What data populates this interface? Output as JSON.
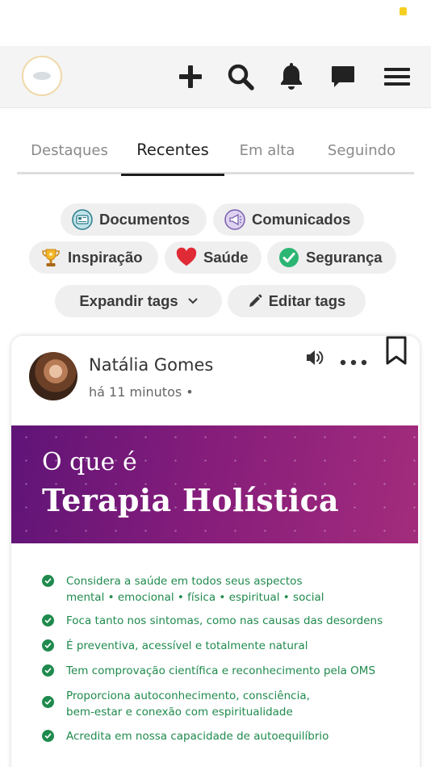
{
  "header": {
    "logo_name": "company-logo",
    "actions": [
      "add-icon",
      "search-icon",
      "bell-icon",
      "chat-icon",
      "menu-icon"
    ]
  },
  "tabs": [
    {
      "label": "Destaques",
      "active": false
    },
    {
      "label": "Recentes",
      "active": true
    },
    {
      "label": "Em alta",
      "active": false
    },
    {
      "label": "Seguindo",
      "active": false
    }
  ],
  "tags": [
    {
      "label": "Documentos",
      "icon": "newspaper-icon"
    },
    {
      "label": "Comunicados",
      "icon": "megaphone-icon"
    },
    {
      "label": "Inspiração",
      "icon": "trophy-icon"
    },
    {
      "label": "Saúde",
      "icon": "heart-icon"
    },
    {
      "label": "Segurança",
      "icon": "check-icon"
    }
  ],
  "tag_actions": {
    "expand_label": "Expandir tags",
    "edit_label": "Editar tags"
  },
  "post": {
    "author": "Natália Gomes",
    "time": "há 11 minutos •",
    "image": {
      "line1": "O que é",
      "line2": "Terapia Holística"
    },
    "list": [
      "Considera a saúde em todos seus aspectos\nmental • emocional • física • espiritual • social",
      "Foca tanto nos sintomas, como nas causas das desordens",
      "É preventiva, acessível e totalmente natural",
      "Tem comprovação científica e reconhecimento pela OMS",
      "Proporciona autoconhecimento, consciência,\nbem-estar e conexão com espiritualidade",
      "Acredita em nossa capacidade de autoequilíbrio"
    ]
  },
  "colors": {
    "accent": "#1c1c1c",
    "banner_start": "#5f1477",
    "banner_end": "#a32c7c",
    "list_green": "#1f8a4d",
    "heart": "#e02a35",
    "check_green": "#2bb673"
  }
}
